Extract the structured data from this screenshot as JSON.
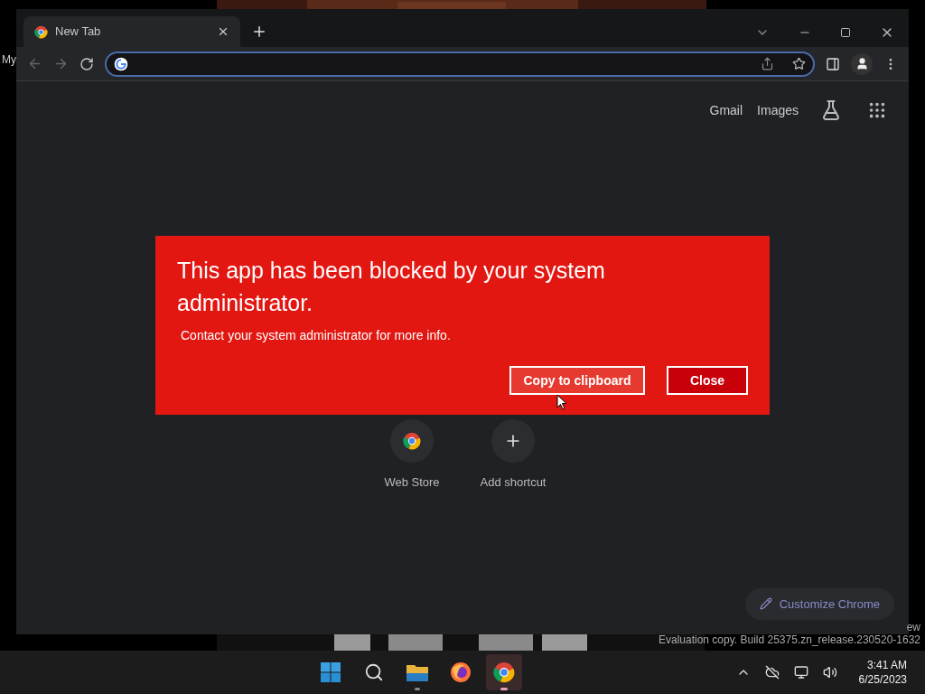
{
  "desktop": {
    "icon_label": "My",
    "watermark": [
      "ew",
      "Evaluation copy. Build 25375.zn_release.230520-1632"
    ]
  },
  "browser": {
    "tabs": [
      {
        "label": "New Tab",
        "selected": true
      }
    ],
    "top_links": [
      "Gmail",
      "Images"
    ],
    "shortcuts": [
      {
        "kind": "store",
        "label": "Web Store"
      },
      {
        "kind": "add",
        "label": "Add shortcut"
      }
    ],
    "customize_button": "Customize Chrome"
  },
  "dialog": {
    "title": "This app has been blocked by your system administrator.",
    "message": "Contact your system administrator for more info.",
    "buttons": [
      {
        "label": "Copy to clipboard",
        "selected": false
      },
      {
        "label": "Close",
        "selected": true
      }
    ]
  },
  "taskbar": {
    "apps": [
      {
        "kind": "start",
        "active": false
      },
      {
        "kind": "search",
        "active": false
      },
      {
        "kind": "files",
        "active": false
      },
      {
        "kind": "firefox",
        "active": false
      },
      {
        "kind": "chrome",
        "active": true
      }
    ],
    "time": "3:41 AM",
    "date": "6/25/2023"
  }
}
